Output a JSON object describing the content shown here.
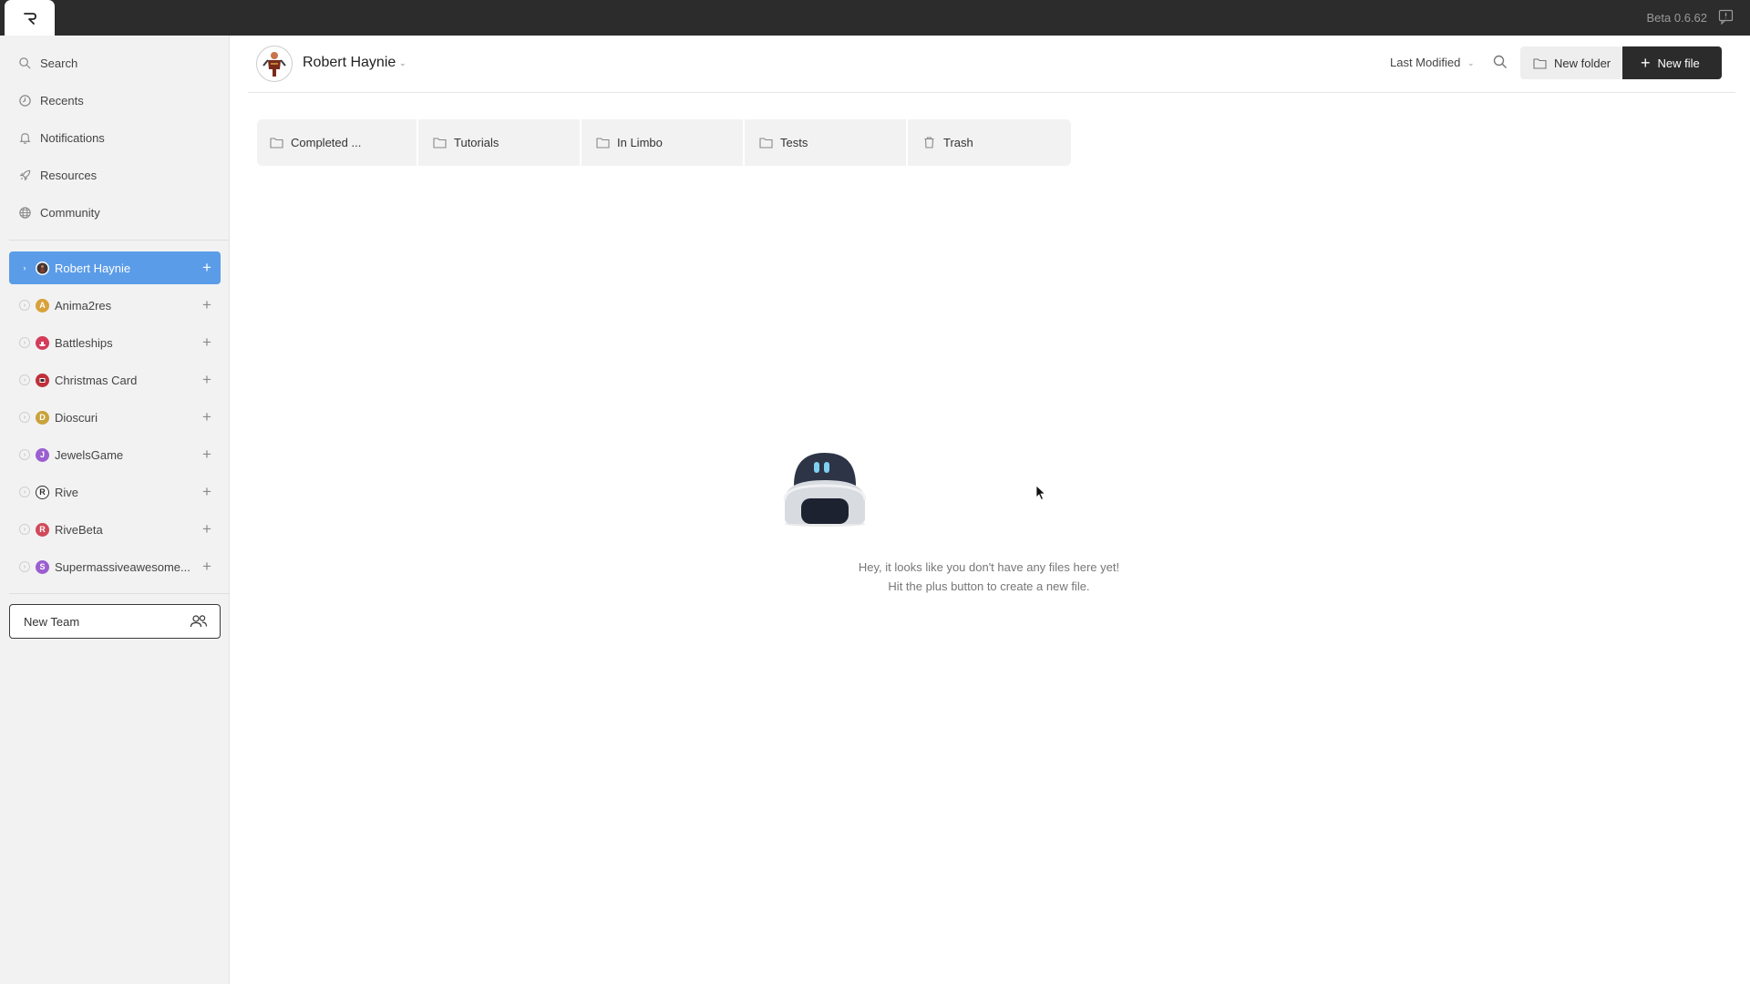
{
  "topbar": {
    "version": "Beta 0.6.62",
    "logo_icon": "rive-logo-icon",
    "feedback_icon": "feedback-icon"
  },
  "sidebar": {
    "nav": [
      {
        "label": "Search",
        "icon": "search-icon"
      },
      {
        "label": "Recents",
        "icon": "clock-icon"
      },
      {
        "label": "Notifications",
        "icon": "bell-icon"
      },
      {
        "label": "Resources",
        "icon": "rocket-icon"
      },
      {
        "label": "Community",
        "icon": "globe-icon"
      }
    ],
    "teams": [
      {
        "name": "Robert Haynie",
        "active": true,
        "avatar_letter": "",
        "avatar_color": "#3a3a3a"
      },
      {
        "name": "Anima2res",
        "active": false,
        "avatar_letter": "A",
        "avatar_color": "#d8a23a"
      },
      {
        "name": "Battleships",
        "active": false,
        "avatar_letter": "",
        "avatar_color": "#d43c5a"
      },
      {
        "name": "Christmas Card",
        "active": false,
        "avatar_letter": "",
        "avatar_color": "#c0303a"
      },
      {
        "name": "Dioscuri",
        "active": false,
        "avatar_letter": "D",
        "avatar_color": "#c9a23a"
      },
      {
        "name": "JewelsGame",
        "active": false,
        "avatar_letter": "J",
        "avatar_color": "#9a5fd0"
      },
      {
        "name": "Rive",
        "active": false,
        "avatar_letter": "R",
        "avatar_color": "#2c2c2c"
      },
      {
        "name": "RiveBeta",
        "active": false,
        "avatar_letter": "R",
        "avatar_color": "#d14a5a"
      },
      {
        "name": "Supermassiveawesome...",
        "active": false,
        "avatar_letter": "S",
        "avatar_color": "#9a5fd0"
      }
    ],
    "new_team_label": "New Team"
  },
  "header": {
    "user_name": "Robert Haynie",
    "sort_label": "Last Modified",
    "new_folder_label": "New folder",
    "new_file_label": "New file"
  },
  "folders": [
    {
      "label": "Completed ...",
      "icon": "folder-icon"
    },
    {
      "label": "Tutorials",
      "icon": "folder-icon"
    },
    {
      "label": "In Limbo",
      "icon": "folder-icon"
    },
    {
      "label": "Tests",
      "icon": "folder-icon"
    },
    {
      "label": "Trash",
      "icon": "trash-icon"
    }
  ],
  "empty_state": {
    "line1": "Hey, it looks like you don't have any files here yet!",
    "line2": "Hit the plus button to create a new file."
  },
  "colors": {
    "accent": "#5b9ce8",
    "topbar": "#2c2c2c",
    "primary_button": "#2b2b2b"
  }
}
